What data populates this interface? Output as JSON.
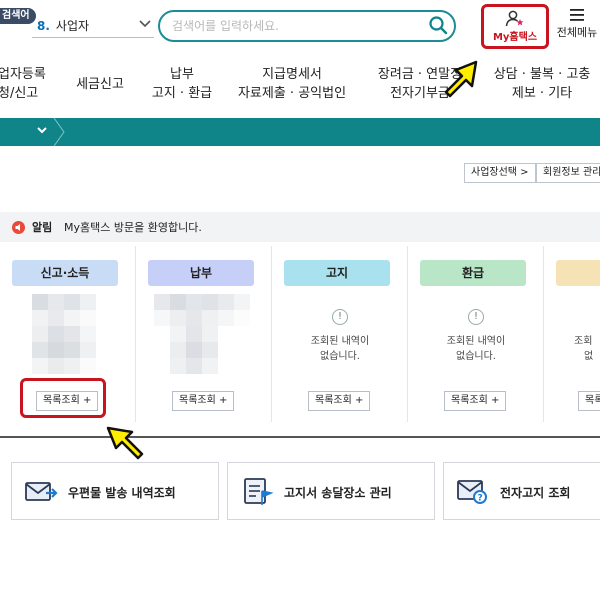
{
  "header": {
    "search_badge": "검색어",
    "business_number": "8.",
    "business_label": "사업자",
    "search_placeholder": "검색어를 입력하세요.",
    "my_hometax": "My홈택스",
    "all_menu": "전체메뉴"
  },
  "nav": {
    "items": [
      {
        "line1": "업자등록",
        "line2": "청/신고"
      },
      {
        "line1": "세금신고",
        "line2": ""
      },
      {
        "line1": "납부",
        "line2": "고지 · 환급"
      },
      {
        "line1": "지급명세서",
        "line2": "자료제출 · 공익법인"
      },
      {
        "line1": "장려금 · 연말정",
        "line2": "전자기부금"
      },
      {
        "line1": "상담 · 불복 · 고충",
        "line2": "제보 · 기타"
      }
    ]
  },
  "buttons": {
    "select_business": "사업장선택 >",
    "member_info": "회원정보 관리"
  },
  "alert": {
    "label": "알림",
    "message": "My홈택스 방문을 환영합니다."
  },
  "cards": [
    {
      "title": "신고·소득",
      "color": "#c9dcf5",
      "list_btn": "목록조회 +",
      "state": "blurred"
    },
    {
      "title": "납부",
      "color": "#c5cff8",
      "list_btn": "목록조회 +",
      "state": "blurred"
    },
    {
      "title": "고지",
      "color": "#a9e2ee",
      "list_btn": "목록조회 +",
      "empty_line1": "조회된 내역이",
      "empty_line2": "없습니다.",
      "state": "empty"
    },
    {
      "title": "환급",
      "color": "#b8e6c6",
      "list_btn": "목록조회 +",
      "empty_line1": "조회된 내역이",
      "empty_line2": "없습니다.",
      "state": "empty"
    },
    {
      "title": "",
      "color": "#f5e3b6",
      "list_btn": "목록",
      "empty_line1": "조회",
      "empty_line2": "없",
      "state": "empty"
    }
  ],
  "services": [
    {
      "label": "우편물 발송 내역조회",
      "icon": "mail-icon"
    },
    {
      "label": "고지서 송달장소 관리",
      "icon": "document-flag-icon"
    },
    {
      "label": "전자고지 조회",
      "icon": "email-search-icon"
    }
  ],
  "colors": {
    "accent_teal": "#0f8589",
    "highlight_red": "#c8141e",
    "cursor_yellow": "#ffee00"
  }
}
